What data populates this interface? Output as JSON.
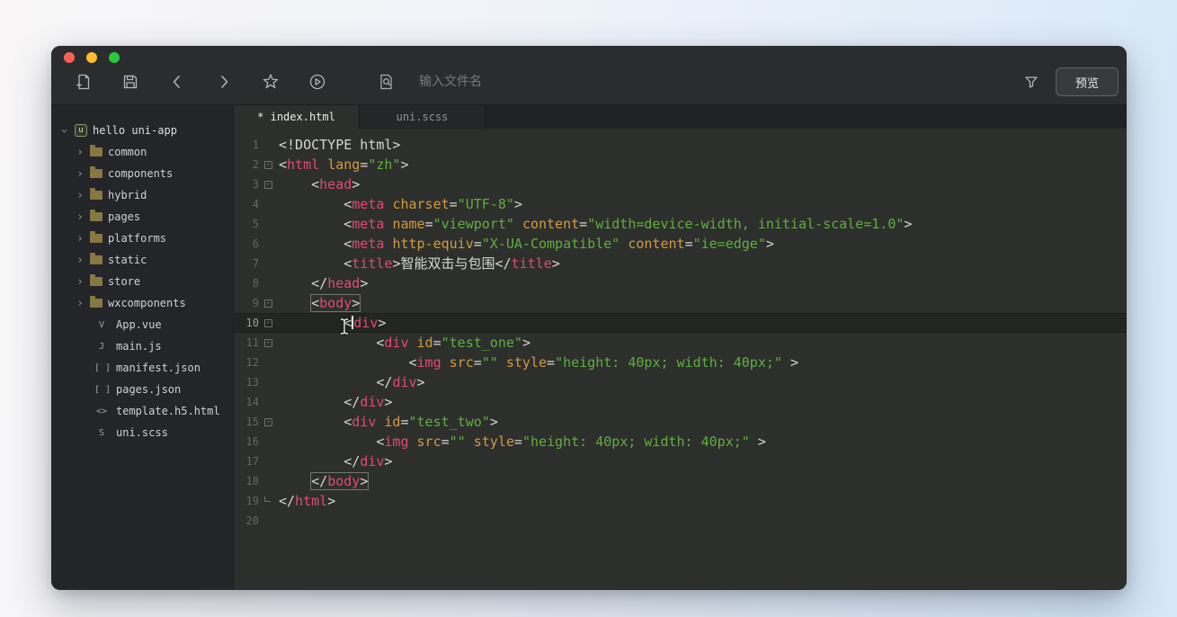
{
  "colors": {
    "tag": "#e2477d",
    "attribute": "#d29a3f",
    "string": "#5fae3f",
    "text": "#d6d6d1",
    "editor_background": "#2d2f2c",
    "traffic_red": "#ff5f57",
    "traffic_yellow": "#febc2e",
    "traffic_green": "#28c840"
  },
  "titlebar": {
    "traffic_lights": [
      "close",
      "minimize",
      "zoom"
    ]
  },
  "toolbar": {
    "icons": [
      "new-file",
      "save",
      "back",
      "forward",
      "star",
      "run",
      "file-search",
      "filter"
    ],
    "search_placeholder": "输入文件名",
    "preview_label": "预览"
  },
  "sidebar": {
    "root_label": "hello uni-app",
    "root_icon": "u",
    "folders": [
      "common",
      "components",
      "hybrid",
      "pages",
      "platforms",
      "static",
      "store",
      "wxcomponents"
    ],
    "files": [
      {
        "label": "App.vue",
        "icon": "V"
      },
      {
        "label": "main.js",
        "icon": "J"
      },
      {
        "label": "manifest.json",
        "icon": "[ ]"
      },
      {
        "label": "pages.json",
        "icon": "[ ]"
      },
      {
        "label": "template.h5.html",
        "icon": "<>"
      },
      {
        "label": "uni.scss",
        "icon": "S"
      }
    ]
  },
  "tabs": [
    {
      "label": "* index.html",
      "active": true
    },
    {
      "label": "uni.scss",
      "active": false
    }
  ],
  "editor": {
    "lines": [
      {
        "n": 1,
        "segs": [
          [
            "p",
            "<!DOCTYPE html>"
          ]
        ]
      },
      {
        "n": 2,
        "fold": true,
        "segs": [
          [
            "p",
            "<"
          ],
          [
            "t",
            "html"
          ],
          [
            "p",
            " "
          ],
          [
            "a",
            "lang"
          ],
          [
            "p",
            "="
          ],
          [
            "s",
            "\"zh\""
          ],
          [
            "p",
            ">"
          ]
        ]
      },
      {
        "n": 3,
        "fold": true,
        "segs": [
          [
            "p",
            "\t<"
          ],
          [
            "t",
            "head"
          ],
          [
            "p",
            ">"
          ]
        ]
      },
      {
        "n": 4,
        "segs": [
          [
            "p",
            "\t\t<"
          ],
          [
            "t",
            "meta"
          ],
          [
            "p",
            " "
          ],
          [
            "a",
            "charset"
          ],
          [
            "p",
            "="
          ],
          [
            "s",
            "\"UTF-8\""
          ],
          [
            "p",
            ">"
          ]
        ]
      },
      {
        "n": 5,
        "segs": [
          [
            "p",
            "\t\t<"
          ],
          [
            "t",
            "meta"
          ],
          [
            "p",
            " "
          ],
          [
            "a",
            "name"
          ],
          [
            "p",
            "="
          ],
          [
            "s",
            "\"viewport\""
          ],
          [
            "p",
            " "
          ],
          [
            "a",
            "content"
          ],
          [
            "p",
            "="
          ],
          [
            "s",
            "\"width=device-width, initial-scale=1.0\""
          ],
          [
            "p",
            ">"
          ]
        ]
      },
      {
        "n": 6,
        "segs": [
          [
            "p",
            "\t\t<"
          ],
          [
            "t",
            "meta"
          ],
          [
            "p",
            " "
          ],
          [
            "a",
            "http-equiv"
          ],
          [
            "p",
            "="
          ],
          [
            "s",
            "\"X-UA-Compatible\""
          ],
          [
            "p",
            " "
          ],
          [
            "a",
            "content"
          ],
          [
            "p",
            "="
          ],
          [
            "s",
            "\"ie=edge\""
          ],
          [
            "p",
            ">"
          ]
        ]
      },
      {
        "n": 7,
        "segs": [
          [
            "p",
            "\t\t<"
          ],
          [
            "t",
            "title"
          ],
          [
            "p",
            ">"
          ],
          [
            "p",
            "智能双击与包围"
          ],
          [
            "p",
            "</"
          ],
          [
            "t",
            "title"
          ],
          [
            "p",
            ">"
          ]
        ]
      },
      {
        "n": 8,
        "segs": [
          [
            "p",
            "\t</"
          ],
          [
            "t",
            "head"
          ],
          [
            "p",
            ">"
          ]
        ]
      },
      {
        "n": 9,
        "fold": true,
        "box": [
          1,
          3
        ],
        "segs": [
          [
            "p",
            "\t"
          ],
          [
            "p",
            "<"
          ],
          [
            "t",
            "body"
          ],
          [
            "p",
            ">"
          ]
        ]
      },
      {
        "n": 10,
        "fold": true,
        "active": true,
        "segs": [
          [
            "p",
            "\t\t<"
          ],
          [
            "caret",
            ""
          ],
          [
            "t",
            "div"
          ],
          [
            "p",
            ">"
          ]
        ]
      },
      {
        "n": 11,
        "fold": true,
        "segs": [
          [
            "p",
            "\t\t\t<"
          ],
          [
            "t",
            "div"
          ],
          [
            "p",
            " "
          ],
          [
            "a",
            "id"
          ],
          [
            "p",
            "="
          ],
          [
            "s",
            "\"test_one\""
          ],
          [
            "p",
            ">"
          ]
        ]
      },
      {
        "n": 12,
        "segs": [
          [
            "p",
            "\t\t\t\t<"
          ],
          [
            "t",
            "img"
          ],
          [
            "p",
            " "
          ],
          [
            "a",
            "src"
          ],
          [
            "p",
            "="
          ],
          [
            "s",
            "\"\""
          ],
          [
            "p",
            " "
          ],
          [
            "a",
            "style"
          ],
          [
            "p",
            "="
          ],
          [
            "s",
            "\"height: 40px; width: 40px;\""
          ],
          [
            "p",
            " >"
          ]
        ]
      },
      {
        "n": 13,
        "segs": [
          [
            "p",
            "\t\t\t</"
          ],
          [
            "t",
            "div"
          ],
          [
            "p",
            ">"
          ]
        ]
      },
      {
        "n": 14,
        "segs": [
          [
            "p",
            "\t\t</"
          ],
          [
            "t",
            "div"
          ],
          [
            "p",
            ">"
          ]
        ]
      },
      {
        "n": 15,
        "fold": true,
        "segs": [
          [
            "p",
            "\t\t<"
          ],
          [
            "t",
            "div"
          ],
          [
            "p",
            " "
          ],
          [
            "a",
            "id"
          ],
          [
            "p",
            "="
          ],
          [
            "s",
            "\"test_two\""
          ],
          [
            "p",
            ">"
          ]
        ]
      },
      {
        "n": 16,
        "segs": [
          [
            "p",
            "\t\t\t<"
          ],
          [
            "t",
            "img"
          ],
          [
            "p",
            " "
          ],
          [
            "a",
            "src"
          ],
          [
            "p",
            "="
          ],
          [
            "s",
            "\"\""
          ],
          [
            "p",
            " "
          ],
          [
            "a",
            "style"
          ],
          [
            "p",
            "="
          ],
          [
            "s",
            "\"height: 40px; width: 40px;\""
          ],
          [
            "p",
            " >"
          ]
        ]
      },
      {
        "n": 17,
        "segs": [
          [
            "p",
            "\t\t</"
          ],
          [
            "t",
            "div"
          ],
          [
            "p",
            ">"
          ]
        ]
      },
      {
        "n": 18,
        "box": [
          1,
          3
        ],
        "segs": [
          [
            "p",
            "\t"
          ],
          [
            "p",
            "</"
          ],
          [
            "t",
            "body"
          ],
          [
            "p",
            ">"
          ]
        ]
      },
      {
        "n": 19,
        "foldEnd": true,
        "segs": [
          [
            "p",
            "</"
          ],
          [
            "t",
            "html"
          ],
          [
            "p",
            ">"
          ]
        ]
      },
      {
        "n": 20,
        "segs": []
      }
    ]
  }
}
